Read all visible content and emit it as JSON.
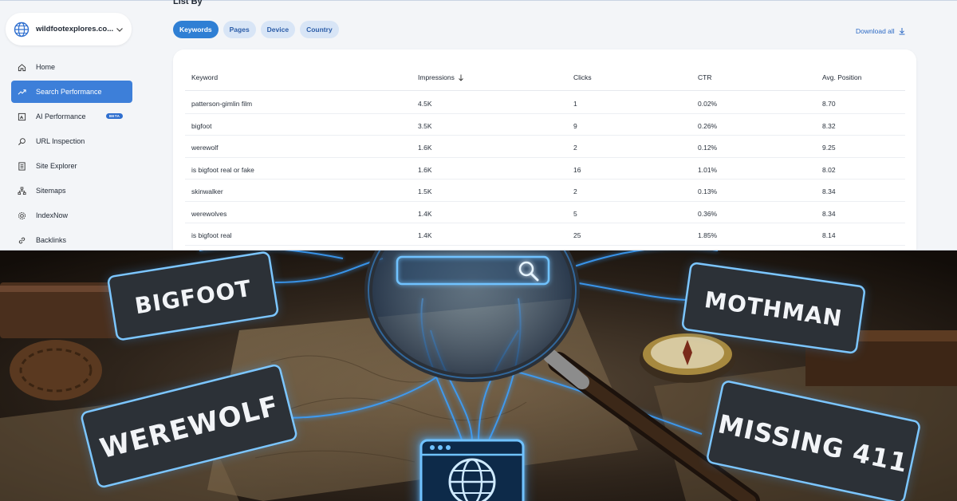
{
  "site": {
    "name": "wildfootexplores.co..."
  },
  "nav": [
    {
      "label": "Home",
      "icon": "home-icon"
    },
    {
      "label": "Search Performance",
      "icon": "trend-icon",
      "active": true
    },
    {
      "label": "AI Performance",
      "icon": "ai-icon",
      "badge": "BETA"
    },
    {
      "label": "URL Inspection",
      "icon": "search-icon"
    },
    {
      "label": "Site Explorer",
      "icon": "document-icon"
    },
    {
      "label": "Sitemaps",
      "icon": "sitemap-icon"
    },
    {
      "label": "IndexNow",
      "icon": "gear-icon"
    },
    {
      "label": "Backlinks",
      "icon": "link-icon"
    }
  ],
  "list_by": {
    "title": "List By",
    "tabs": [
      "Keywords",
      "Pages",
      "Device",
      "Country"
    ],
    "active_tab": "Keywords",
    "download_label": "Download all"
  },
  "table": {
    "columns": [
      "Keyword",
      "Impressions",
      "Clicks",
      "CTR",
      "Avg. Position"
    ],
    "sort_column": "Impressions",
    "rows": [
      [
        "patterson-gimlin film",
        "4.5K",
        "1",
        "0.02%",
        "8.70"
      ],
      [
        "bigfoot",
        "3.5K",
        "9",
        "0.26%",
        "8.32"
      ],
      [
        "werewolf",
        "1.6K",
        "2",
        "0.12%",
        "9.25"
      ],
      [
        "is bigfoot real or fake",
        "1.6K",
        "16",
        "1.01%",
        "8.02"
      ],
      [
        "skinwalker",
        "1.5K",
        "2",
        "0.13%",
        "8.34"
      ],
      [
        "werewolves",
        "1.4K",
        "5",
        "0.36%",
        "8.34"
      ],
      [
        "is bigfoot real",
        "1.4K",
        "25",
        "1.85%",
        "8.14"
      ]
    ]
  },
  "illustration": {
    "tags": [
      "BIGFOOT",
      "MOTHMAN",
      "WEREWOLF",
      "MISSING 411"
    ],
    "glow_color": "#3aa0ff"
  },
  "colors": {
    "accent": "#3d7fd9",
    "tab_active": "#2f7fd4",
    "link": "#2d6ac5"
  }
}
